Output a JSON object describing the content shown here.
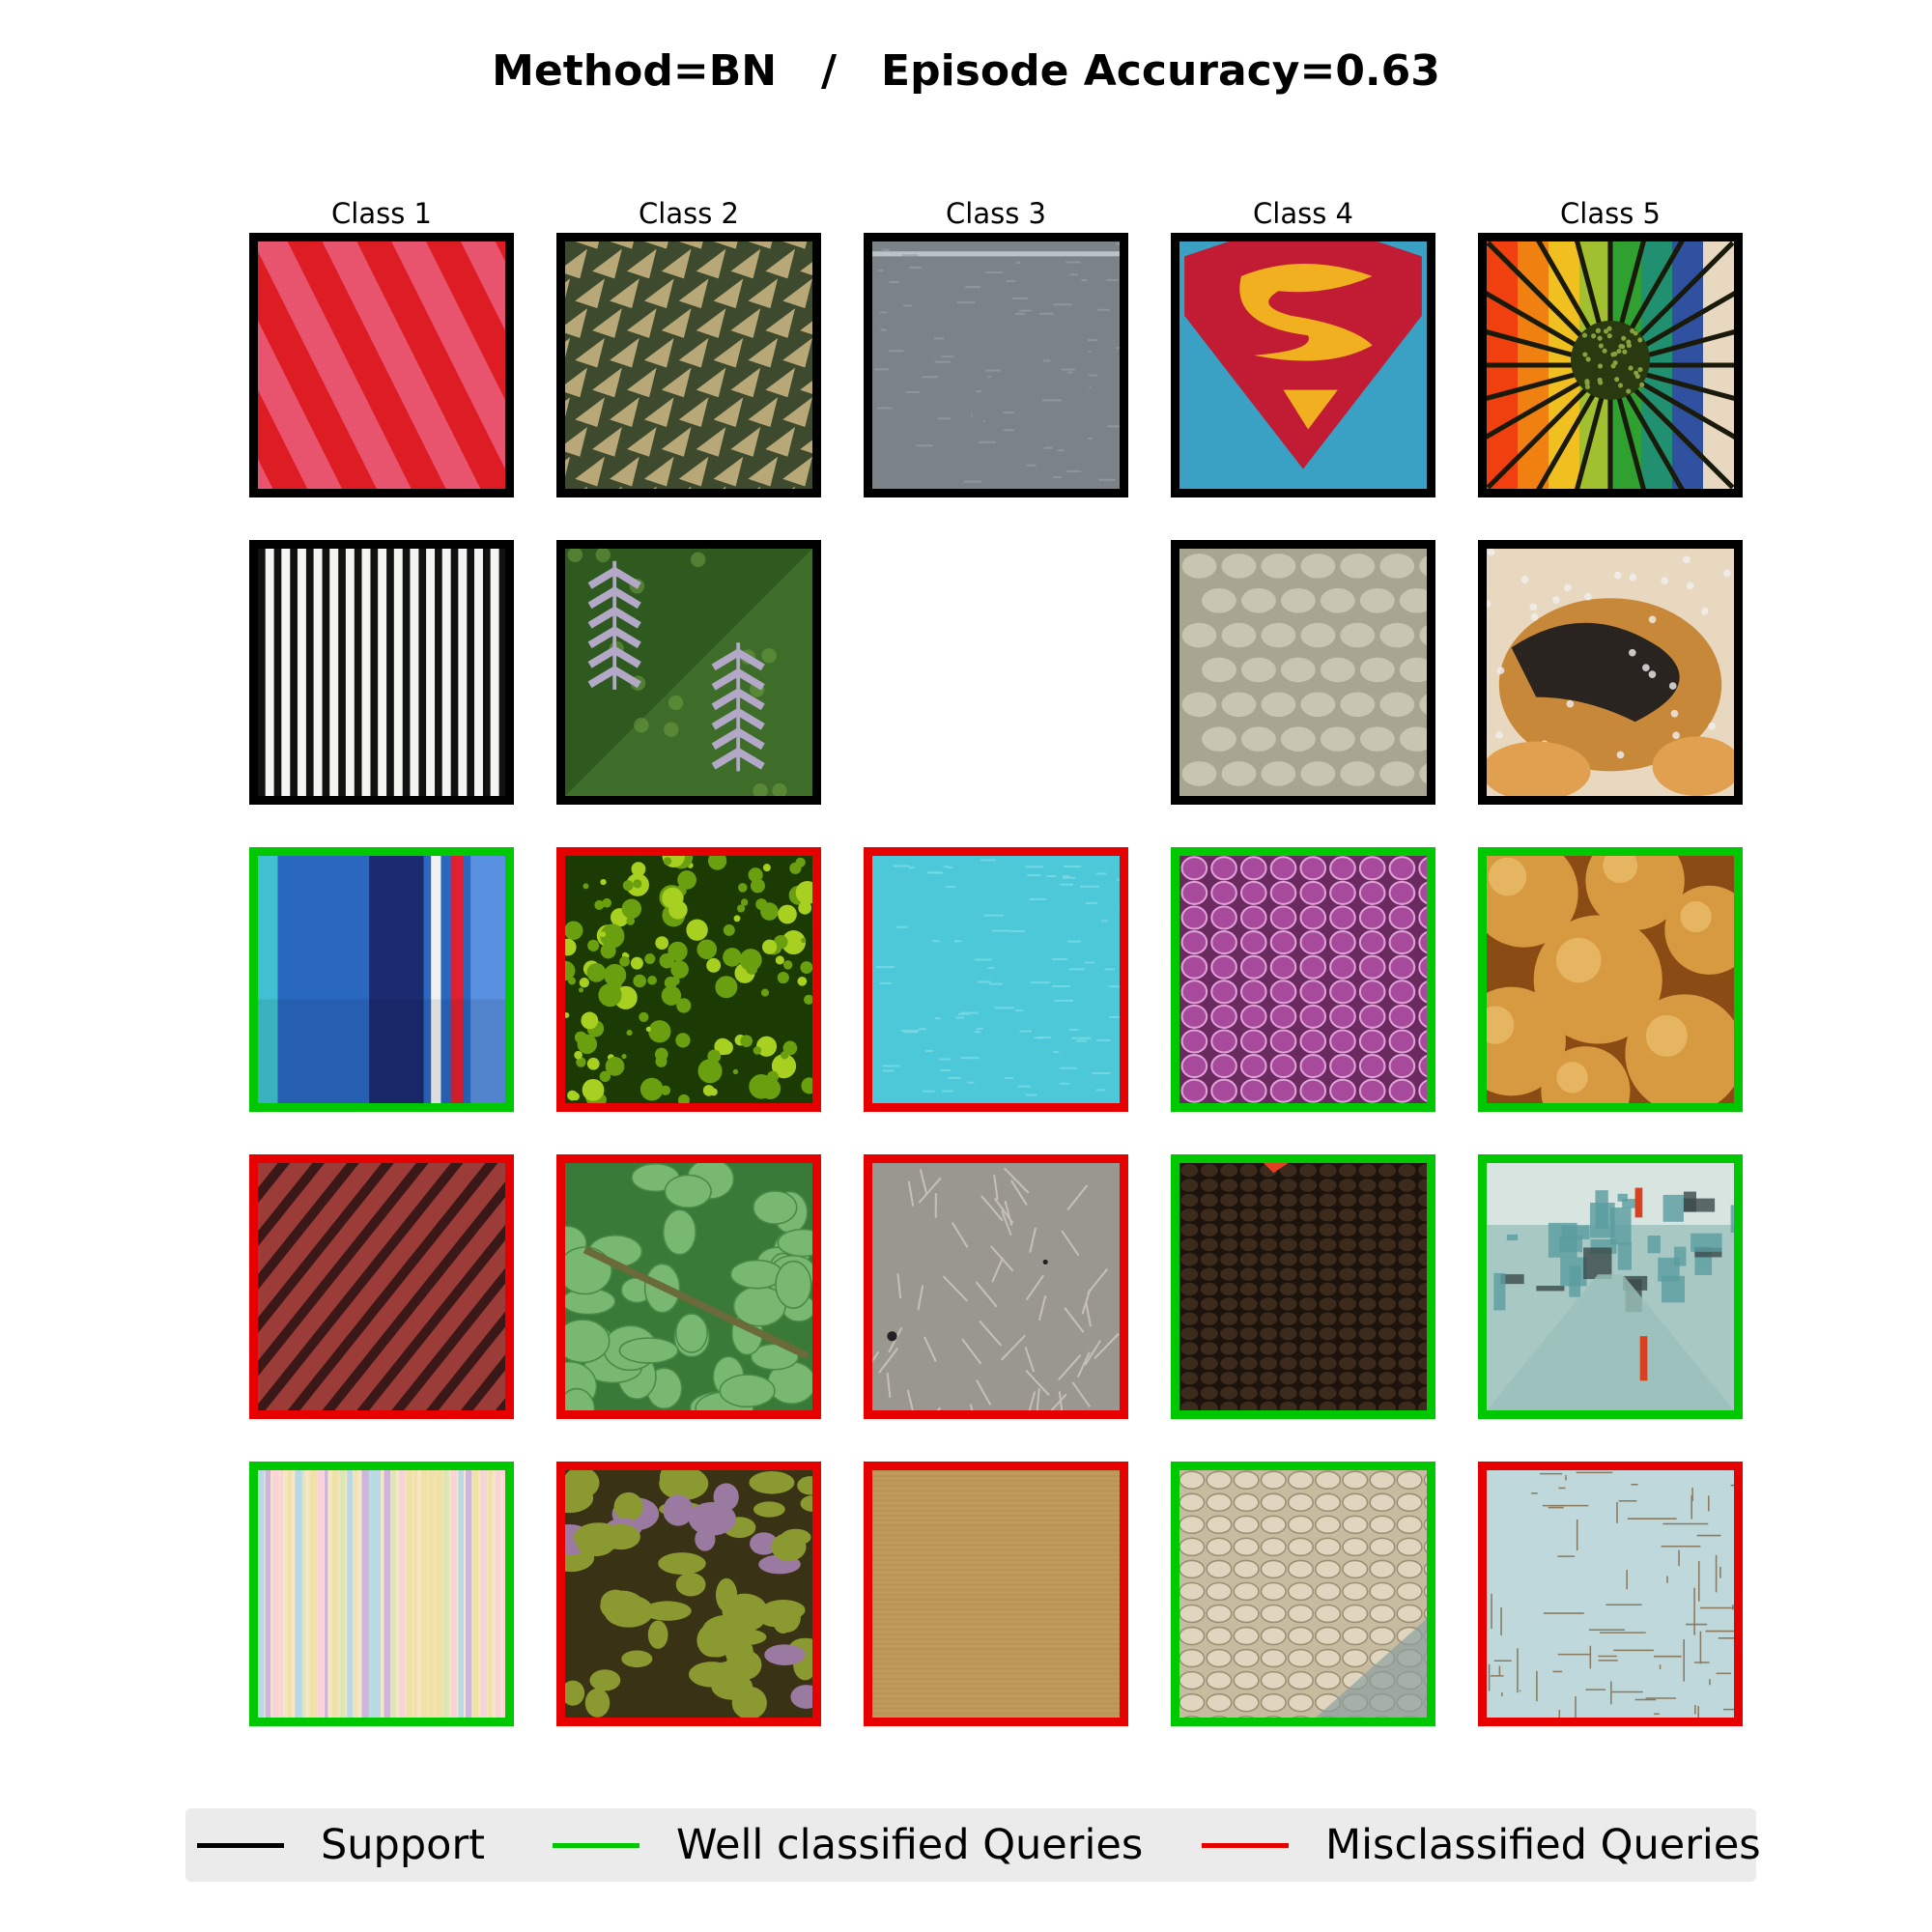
{
  "title": "Method=BN   /   Episode Accuracy=0.63",
  "classes": [
    "Class 1",
    "Class 2",
    "Class 3",
    "Class 4",
    "Class 5"
  ],
  "status_colors": {
    "support": "#000000",
    "well": "#00c800",
    "mis": "#e60000"
  },
  "legend": [
    {
      "label": "Support",
      "color": "#000000"
    },
    {
      "label": "Well classified Queries",
      "color": "#00c800"
    },
    {
      "label": "Misclassified Queries",
      "color": "#e60000"
    }
  ],
  "grid": [
    [
      {
        "status": "support",
        "texture": "diag-stripes",
        "colors": [
          "#e8546e",
          "#de1c24"
        ]
      },
      {
        "status": "support",
        "texture": "spikes",
        "colors": [
          "#3d4a2e",
          "#b8a878"
        ]
      },
      {
        "status": "support",
        "texture": "denim",
        "colors": [
          "#7b8388",
          "#96a0a4"
        ]
      },
      {
        "status": "support",
        "texture": "superman",
        "colors": [
          "#3aa0c4",
          "#c21c34",
          "#f0b020"
        ]
      },
      {
        "status": "support",
        "texture": "flower",
        "colors": [
          "#2a3a10",
          "#f08010",
          "#30a030"
        ]
      }
    ],
    [
      {
        "status": "support",
        "texture": "bw-stripes",
        "colors": [
          "#111111",
          "#f4f4f0"
        ]
      },
      {
        "status": "support",
        "texture": "leaf-earrings",
        "colors": [
          "#2e5a20",
          "#b4a8c8"
        ]
      },
      {
        "status": "empty"
      },
      {
        "status": "support",
        "texture": "knit",
        "colors": [
          "#a8a690",
          "#cfcdb8"
        ]
      },
      {
        "status": "support",
        "texture": "pastry",
        "colors": [
          "#c8883a",
          "#2a2420"
        ]
      }
    ],
    [
      {
        "status": "well",
        "texture": "blue-stripes",
        "colors": [
          "#2a68c0",
          "#1c2a70",
          "#e02030"
        ]
      },
      {
        "status": "mis",
        "texture": "moss",
        "colors": [
          "#6aa010",
          "#1c3a04"
        ]
      },
      {
        "status": "mis",
        "texture": "cyan-linen",
        "colors": [
          "#4cc8d8",
          "#7adce6"
        ]
      },
      {
        "status": "well",
        "texture": "purple-knit",
        "colors": [
          "#a84a9c",
          "#e0a0d8"
        ]
      },
      {
        "status": "well",
        "texture": "buns",
        "colors": [
          "#d89a40",
          "#8a4c14"
        ]
      }
    ],
    [
      {
        "status": "mis",
        "texture": "red-stripes",
        "colors": [
          "#9c3c38",
          "#3a1818"
        ]
      },
      {
        "status": "mis",
        "texture": "green-leaf",
        "colors": [
          "#78b870",
          "#3a7a38"
        ]
      },
      {
        "status": "mis",
        "texture": "grey-wood",
        "colors": [
          "#9a9690",
          "#c4c0b8"
        ]
      },
      {
        "status": "well",
        "texture": "brown-knit",
        "colors": [
          "#3c2a1c",
          "#1c140c"
        ]
      },
      {
        "status": "well",
        "texture": "painting",
        "colors": [
          "#5a9ca0",
          "#a8c8c4",
          "#d84020"
        ]
      }
    ],
    [
      {
        "status": "well",
        "texture": "pastel-stripes",
        "colors": [
          "#f6e6c8",
          "#c8b0e0",
          "#b0d8e8"
        ]
      },
      {
        "status": "mis",
        "texture": "lichen",
        "colors": [
          "#8a9a30",
          "#3a3214"
        ]
      },
      {
        "status": "mis",
        "texture": "burlap",
        "colors": [
          "#c09a5a",
          "#b08a4a"
        ]
      },
      {
        "status": "well",
        "texture": "rope-knit",
        "colors": [
          "#c8bca0",
          "#8ca0a0"
        ]
      },
      {
        "status": "mis",
        "texture": "scratched",
        "colors": [
          "#bed8dc",
          "#8a7a60"
        ]
      }
    ]
  ]
}
